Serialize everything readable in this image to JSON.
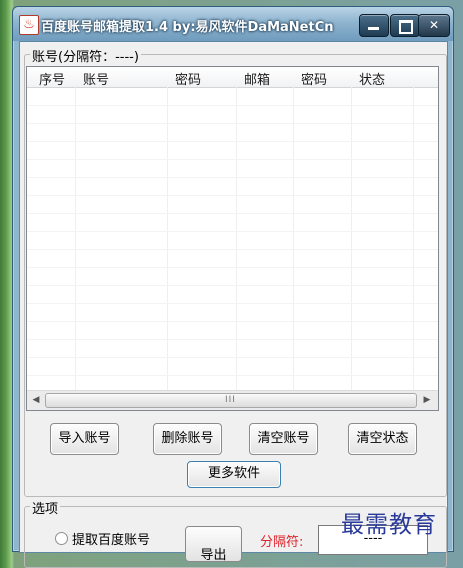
{
  "window": {
    "title": "百度账号邮箱提取1.4 by:易风软件DaMaNet",
    "title_logo_text": "Cn",
    "app_icon_glyph": "♨"
  },
  "account_group": {
    "label": "账号(分隔符：----)",
    "columns": [
      "序号",
      "账号",
      "密码",
      "邮箱",
      "密码",
      "状态"
    ]
  },
  "scrollbar": {
    "left_arrow": "◀",
    "right_arrow": "▶",
    "grip": "III"
  },
  "buttons": {
    "import": "导入账号",
    "delete": "删除账号",
    "clear_accounts": "清空账号",
    "clear_status": "清空状态",
    "more_software": "更多软件",
    "partial": "导出"
  },
  "options_group": {
    "label": "选项",
    "radio_label": "提取百度账号",
    "separator_label": "分隔符:",
    "separator_value": "----"
  },
  "watermark": "最需教育",
  "colors": {
    "accent_red": "#e0232a",
    "title_bar": "#8fb4cf"
  }
}
